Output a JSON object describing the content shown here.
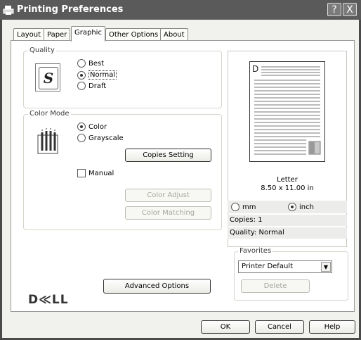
{
  "window": {
    "title": "Printing Preferences",
    "help_btn": "?",
    "close_btn": "X"
  },
  "tabs": [
    {
      "label": "Layout"
    },
    {
      "label": "Paper"
    },
    {
      "label": "Graphic"
    },
    {
      "label": "Other Options"
    },
    {
      "label": "About"
    }
  ],
  "active_tab": "Graphic",
  "quality": {
    "legend": "Quality",
    "options": [
      "Best",
      "Normal",
      "Draft"
    ],
    "selected": "Normal"
  },
  "color_mode": {
    "legend": "Color Mode",
    "options": [
      "Color",
      "Grayscale"
    ],
    "selected": "Color",
    "copies_setting_btn": "Copies Setting",
    "manual_label": "Manual",
    "manual_checked": false,
    "color_adjust_btn": "Color Adjust",
    "color_matching_btn": "Color Matching"
  },
  "advanced_options_btn": "Advanced Options",
  "brand": "D≪LL",
  "preview": {
    "paper_name": "Letter",
    "paper_size": "8.50 x 11.00 in",
    "letter": "D",
    "units": [
      "mm",
      "inch"
    ],
    "unit_selected": "inch",
    "copies": "Copies: 1",
    "quality": "Quality: Normal"
  },
  "favorites": {
    "legend": "Favorites",
    "selected": "Printer Default",
    "delete_btn": "Delete"
  },
  "footer": {
    "ok": "OK",
    "cancel": "Cancel",
    "help": "Help"
  }
}
